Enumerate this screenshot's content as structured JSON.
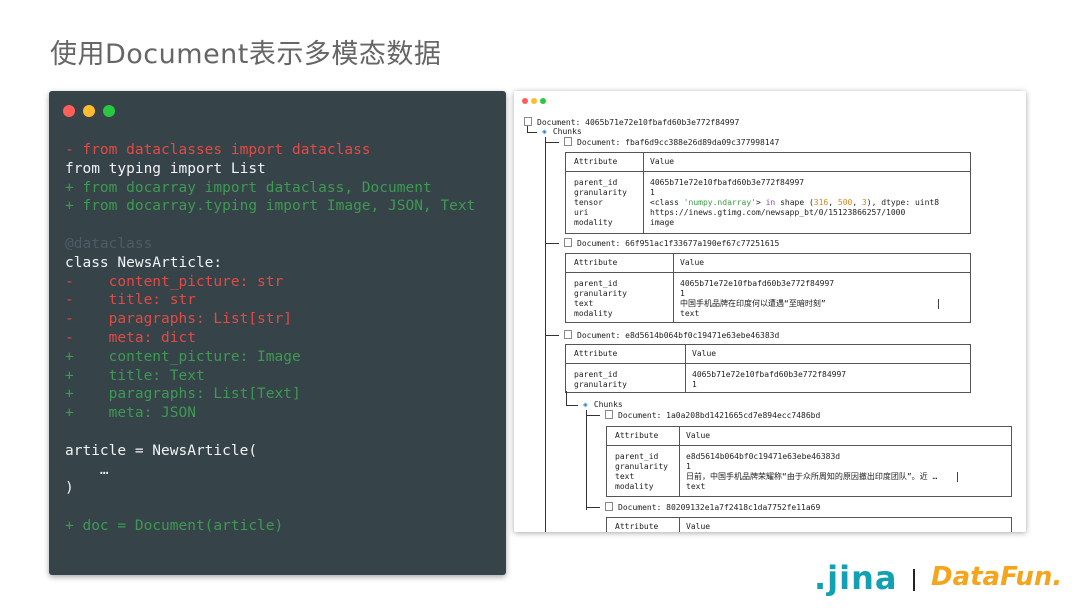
{
  "title": "使用Document表示多模态数据",
  "code": {
    "lines": [
      {
        "text": "- from dataclasses import dataclass",
        "style": "red"
      },
      {
        "text": "from typing import List",
        "style": "white"
      },
      {
        "text": "+ from docarray import dataclass, Document",
        "style": "green"
      },
      {
        "text": "+ from docarray.typing import Image, JSON, Text",
        "style": "green"
      },
      {
        "text": "",
        "style": "white"
      },
      {
        "text": "@dataclass",
        "style": "dim"
      },
      {
        "text": "class NewsArticle:",
        "style": "white"
      },
      {
        "text": "-    content_picture: str",
        "style": "red"
      },
      {
        "text": "-    title: str",
        "style": "red"
      },
      {
        "text": "-    paragraphs: List[str]",
        "style": "red"
      },
      {
        "text": "-    meta: dict",
        "style": "red"
      },
      {
        "text": "+    content_picture: Image",
        "style": "green"
      },
      {
        "text": "+    title: Text",
        "style": "green"
      },
      {
        "text": "+    paragraphs: List[Text]",
        "style": "green"
      },
      {
        "text": "+    meta: JSON",
        "style": "green"
      },
      {
        "text": "",
        "style": "white"
      },
      {
        "text": "article = NewsArticle(",
        "style": "white"
      },
      {
        "text": "    …",
        "style": "white"
      },
      {
        "text": ")",
        "style": "white"
      },
      {
        "text": "",
        "style": "white"
      },
      {
        "text": "+ doc = Document(article)",
        "style": "green"
      }
    ]
  },
  "terminal": {
    "root": "Document: 4065b71e72e10fbafd60b3e772f84997",
    "chunks_label": "Chunks",
    "col_attribute": "Attribute",
    "col_value": "Value",
    "doc1": {
      "header": "Document: fbaf6d9cc388e26d89da09c377998147",
      "attrs": "parent_id\ngranularity\ntensor\nuri\nmodality",
      "v_parent": "4065b71e72e10fbafd60b3e772f84997",
      "v_gran": "1",
      "v_tensor_a": "<class ",
      "v_tensor_b": "'numpy.ndarray'",
      "v_tensor_c": "> ",
      "v_tensor_d": "in",
      "v_tensor_e": " shape (",
      "v_tensor_f": "316",
      "v_tensor_g": ", ",
      "v_tensor_h": "500",
      "v_tensor_i": ", ",
      "v_tensor_j": "3",
      "v_tensor_k": "), dtype: uint8",
      "v_uri": "https://inews.gtimg.com/newsapp_bt/0/15123866257/1000",
      "v_modality": "image"
    },
    "doc2": {
      "header": "Document: 66f951ac1f33677a190ef67c77251615",
      "attrs": "parent_id\ngranularity\ntext\nmodality",
      "v_parent": "4065b71e72e10fbafd60b3e772f84997",
      "v_gran": "1",
      "v_text": "中国手机品牌在印度何以遭遇“至暗时刻”",
      "v_modality": "text"
    },
    "doc3": {
      "header": "Document: e8d5614b064bf0c19471e63ebe46383d",
      "attrs": "parent_id\ngranularity",
      "v_parent": "4065b71e72e10fbafd60b3e772f84997",
      "v_gran": "1"
    },
    "doc3_chunks_label": "Chunks",
    "doc4": {
      "header": "Document: 1a0a208bd1421665cd7e894ecc7486bd",
      "attrs": "parent_id\ngranularity\ntext\nmodality",
      "v_parent": "e8d5614b064bf0c19471e63ebe46383d",
      "v_gran": "1",
      "v_text": "日前，中国手机品牌荣耀称“由于众所周知的原因撤出印度团队”。近 …",
      "v_modality": "text"
    },
    "doc5": {
      "header": "Document: 80209132e1a7f2418c1da7752fe11a69"
    }
  },
  "footer": {
    "logo_jina": ".jina",
    "logo_datafun": "DataFun."
  },
  "colors": {
    "code_bg": "#364349",
    "removed": "#e24a44",
    "added": "#3d9a52",
    "number": "#d08a16",
    "string": "#3a9a45",
    "jina": "#12a0b3",
    "datafun": "#f4a51e"
  }
}
